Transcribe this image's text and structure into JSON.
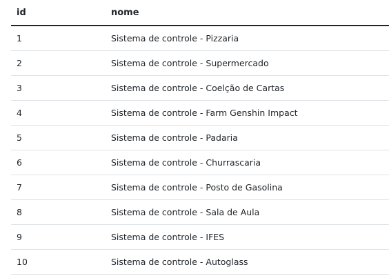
{
  "table": {
    "columns": [
      "id",
      "nome"
    ],
    "rows": [
      {
        "id": "1",
        "nome": "Sistema de controle - Pizzaria"
      },
      {
        "id": "2",
        "nome": "Sistema de controle - Supermercado"
      },
      {
        "id": "3",
        "nome": "Sistema de controle - Coelção de Cartas"
      },
      {
        "id": "4",
        "nome": "Sistema de controle - Farm Genshin Impact"
      },
      {
        "id": "5",
        "nome": "Sistema de controle - Padaria"
      },
      {
        "id": "6",
        "nome": "Sistema de controle - Churrascaria"
      },
      {
        "id": "7",
        "nome": "Sistema de controle - Posto de Gasolina"
      },
      {
        "id": "8",
        "nome": "Sistema de controle - Sala de Aula"
      },
      {
        "id": "9",
        "nome": "Sistema de controle - IFES"
      },
      {
        "id": "10",
        "nome": "Sistema de controle - Autoglass"
      }
    ]
  }
}
